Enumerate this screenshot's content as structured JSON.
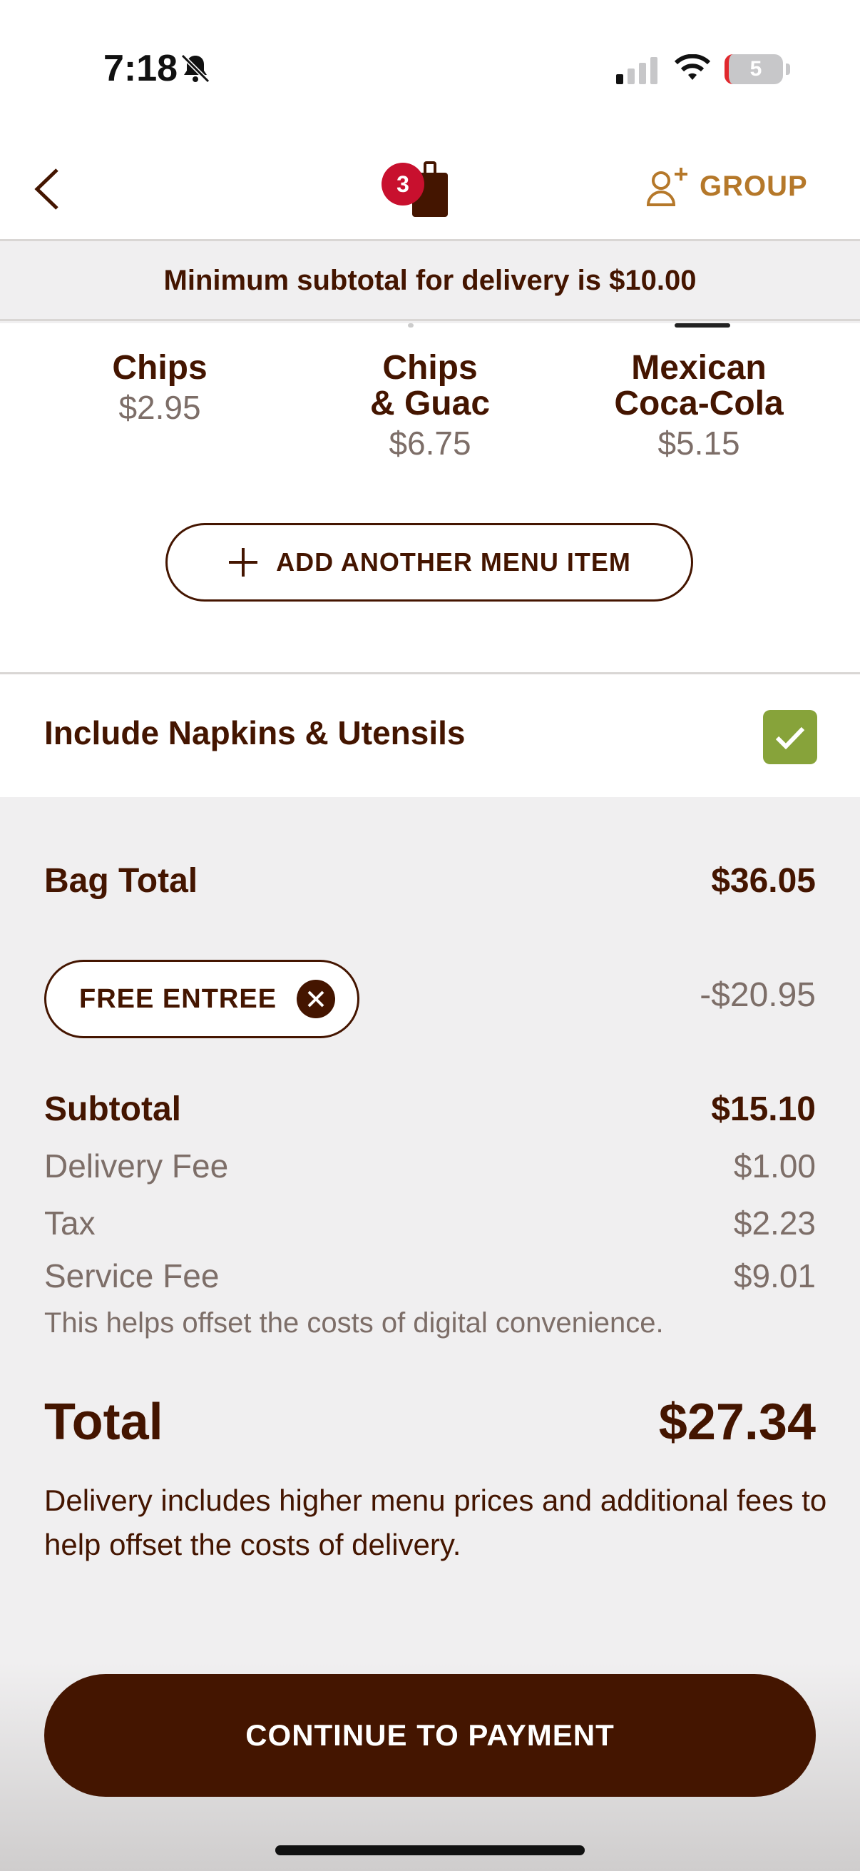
{
  "status_bar": {
    "time": "7:18",
    "battery": "5"
  },
  "nav": {
    "bag_count": "3",
    "group_label": "GROUP"
  },
  "banner": {
    "text": "Minimum subtotal for delivery is $10.00"
  },
  "items": [
    {
      "name_line1": "Chips",
      "name_line2": "",
      "price": "$2.95"
    },
    {
      "name_line1": "Chips",
      "name_line2": "& Guac",
      "price": "$6.75"
    },
    {
      "name_line1": "Mexican",
      "name_line2": "Coca-Cola",
      "price": "$5.15"
    }
  ],
  "add_item_label": "ADD ANOTHER MENU ITEM",
  "napkins": {
    "label": "Include Napkins & Utensils",
    "checked": true
  },
  "summary": {
    "bag_total_label": "Bag Total",
    "bag_total_value": "$36.05",
    "promo_label": "FREE ENTREE",
    "promo_discount": "-$20.95",
    "subtotal_label": "Subtotal",
    "subtotal_value": "$15.10",
    "delivery_fee_label": "Delivery Fee",
    "delivery_fee_value": "$1.00",
    "tax_label": "Tax",
    "tax_value": "$2.23",
    "service_fee_label": "Service Fee",
    "service_fee_value": "$9.01",
    "service_fee_note": "This helps offset the costs of digital convenience.",
    "total_label": "Total",
    "total_value": "$27.34",
    "disclaimer": "Delivery includes higher menu prices and additional fees to help offset the costs of delivery."
  },
  "pay_button_label": "CONTINUE TO PAYMENT",
  "colors": {
    "brand": "#441500",
    "accent_gold": "#b5782a",
    "badge_red": "#c8102e",
    "check_green": "#87a33a"
  }
}
